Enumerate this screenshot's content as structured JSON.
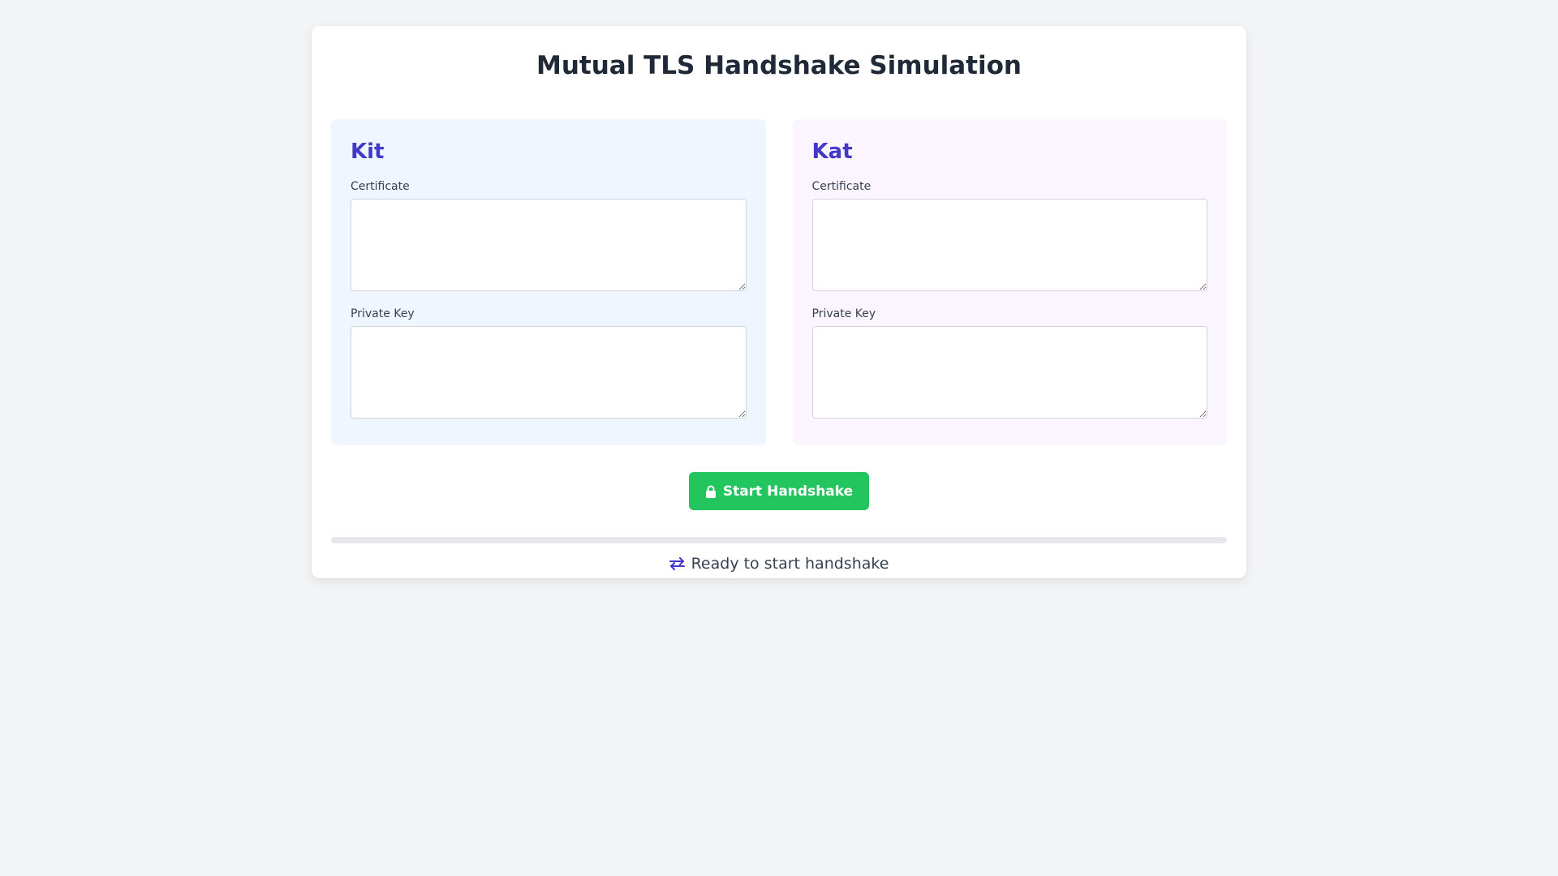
{
  "page": {
    "title": "Mutual TLS Handshake Simulation"
  },
  "parties": [
    {
      "name": "Kit",
      "certificate_label": "Certificate",
      "certificate_value": "",
      "private_key_label": "Private Key",
      "private_key_value": ""
    },
    {
      "name": "Kat",
      "certificate_label": "Certificate",
      "certificate_value": "",
      "private_key_label": "Private Key",
      "private_key_value": ""
    }
  ],
  "actions": {
    "start_label": "Start Handshake",
    "start_icon": "lock-icon"
  },
  "progress": {
    "percent": 0
  },
  "status": {
    "icon": "swap-arrows-icon",
    "text": "Ready to start handshake"
  },
  "colors": {
    "accent": "#4338ca",
    "button": "#22c55e",
    "kit_panel": "#eff6ff",
    "kat_panel": "#faf5ff"
  }
}
